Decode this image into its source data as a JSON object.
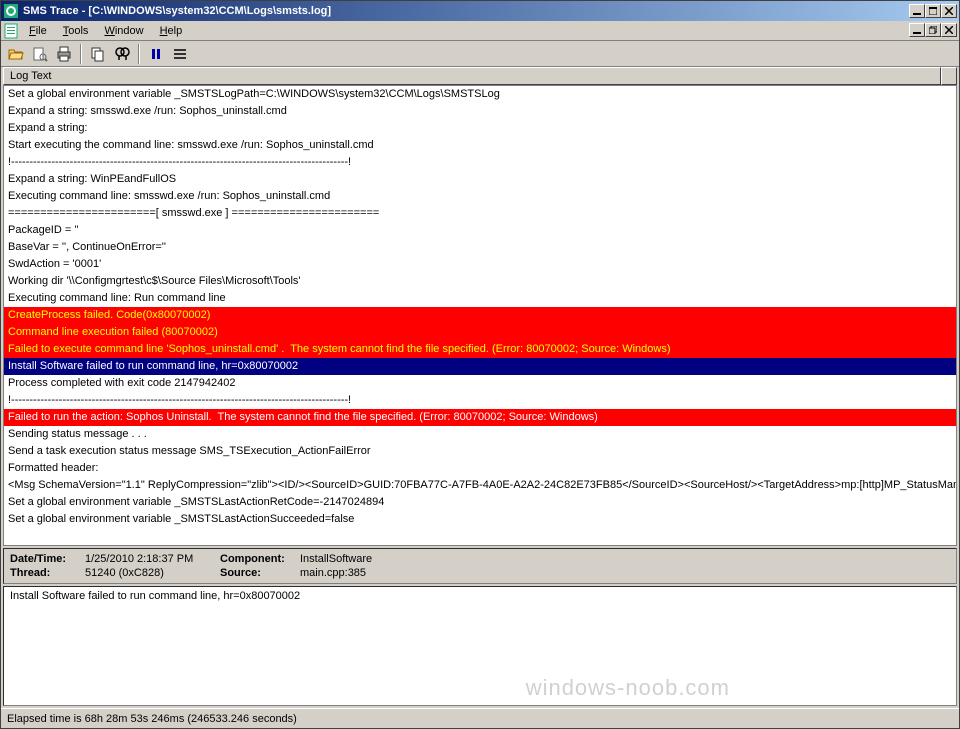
{
  "window": {
    "title": "SMS Trace - [C:\\WINDOWS\\system32\\CCM\\Logs\\smsts.log]"
  },
  "menu": {
    "file": "File",
    "tools": "Tools",
    "window": "Window",
    "help": "Help"
  },
  "column_header": "Log Text",
  "log_lines": [
    {
      "text": "Set a global environment variable _SMSTSLogPath=C:\\WINDOWS\\system32\\CCM\\Logs\\SMSTSLog",
      "style": ""
    },
    {
      "text": "Expand a string: smsswd.exe /run: Sophos_uninstall.cmd",
      "style": ""
    },
    {
      "text": "Expand a string:",
      "style": ""
    },
    {
      "text": "Start executing the command line: smsswd.exe /run: Sophos_uninstall.cmd",
      "style": ""
    },
    {
      "text": "!--------------------------------------------------------------------------------------------!",
      "style": ""
    },
    {
      "text": "Expand a string: WinPEandFullOS",
      "style": ""
    },
    {
      "text": "Executing command line: smsswd.exe /run: Sophos_uninstall.cmd",
      "style": ""
    },
    {
      "text": "=======================[ smsswd.exe ] =======================",
      "style": ""
    },
    {
      "text": "PackageID = ''",
      "style": ""
    },
    {
      "text": "BaseVar = '', ContinueOnError=''",
      "style": ""
    },
    {
      "text": "SwdAction = '0001'",
      "style": ""
    },
    {
      "text": "Working dir '\\\\Configmgrtest\\c$\\Source Files\\Microsoft\\Tools'",
      "style": ""
    },
    {
      "text": "Executing command line: Run command line",
      "style": ""
    },
    {
      "text": "CreateProcess failed. Code(0x80070002)",
      "style": "error"
    },
    {
      "text": "Command line execution failed (80070002)",
      "style": "error"
    },
    {
      "text": "Failed to execute command line 'Sophos_uninstall.cmd' .  The system cannot find the file specified. (Error: 80070002; Source: Windows)",
      "style": "error"
    },
    {
      "text": "Install Software failed to run command line, hr=0x80070002",
      "style": "selected"
    },
    {
      "text": "Process completed with exit code 2147942402",
      "style": ""
    },
    {
      "text": "!--------------------------------------------------------------------------------------------!",
      "style": ""
    },
    {
      "text": "Failed to run the action: Sophos Uninstall.  The system cannot find the file specified. (Error: 80070002; Source: Windows)",
      "style": "error-white"
    },
    {
      "text": "Sending status message . . .",
      "style": ""
    },
    {
      "text": "Send a task execution status message SMS_TSExecution_ActionFailError",
      "style": ""
    },
    {
      "text": "Formatted header:",
      "style": ""
    },
    {
      "text": "<Msg SchemaVersion=\"1.1\" ReplyCompression=\"zlib\"><ID/><SourceID>GUID:70FBA77C-A7FB-4A0E-A2A2-24C82E73FB85</SourceID><SourceHost/><TargetAddress>mp:[http]MP_StatusMana",
      "style": ""
    },
    {
      "text": "Set a global environment variable _SMSTSLastActionRetCode=-2147024894",
      "style": ""
    },
    {
      "text": "Set a global environment variable _SMSTSLastActionSucceeded=false",
      "style": ""
    }
  ],
  "details": {
    "datetime_label": "Date/Time:",
    "datetime_value": "1/25/2010 2:18:37 PM",
    "component_label": "Component:",
    "component_value": "InstallSoftware",
    "thread_label": "Thread:",
    "thread_value": "51240 (0xC828)",
    "source_label": "Source:",
    "source_value": "main.cpp:385"
  },
  "message_box": "Install Software failed to run command line, hr=0x80070002",
  "statusbar": "Elapsed time is 68h 28m 53s 246ms (246533.246 seconds)",
  "watermark": "windows-noob.com"
}
